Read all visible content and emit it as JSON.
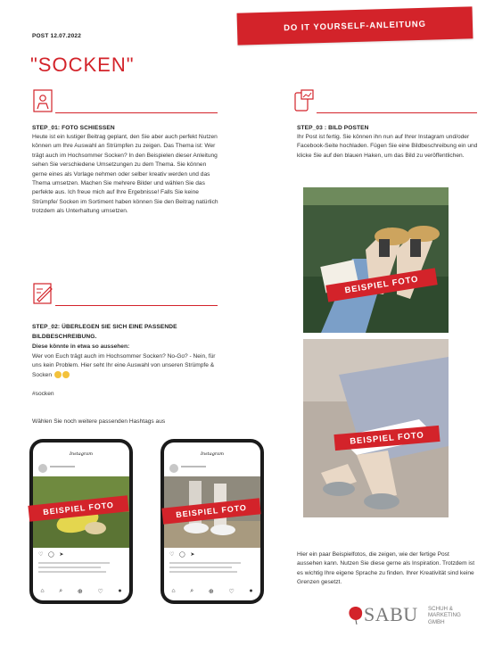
{
  "header": {
    "post_date": "POST 12.07.2022",
    "banner": "DO IT YOURSELF-ANLEITUNG",
    "title": "\"SOCKEN\""
  },
  "step1": {
    "heading": "STEP_01: FOTO SCHIESSEN",
    "text": "Heute ist ein lustiger Beitrag geplant, den Sie aber auch perfekt Nutzen können um Ihre Auswahl an Strümpfen zu zeigen. Das Thema ist: Wer trägt auch im Hochsommer Socken? In den Beispielen dieser Anleitung sehen Sie verschiedene Umsetzungen zu dem Thema. Sie können gerne eines als Vorlage nehmen oder selber kreativ werden und das Thema umsetzen. Machen Sie mehrere Bilder und wählen Sie das perfekte aus. Ich freue mich auf Ihre Ergebnisse! Falls Sie keine Strümpfe/ Socken im Sortiment haben können Sie den Beitrag natürlich trotzdem als Unterhaltung umsetzen."
  },
  "step2": {
    "heading_line1": "STEP_02: ÜBERLEGEN SIE SICH EINE PASSENDE",
    "heading_line2": "BILDBESCHREIBUNG.",
    "intro": "Diese könnte in etwa so aussehen:",
    "caption_text": "Wer von Euch trägt auch im Hochsommer Socken? No-Go? - Nein, für uns kein Problem. Hier seht Ihr eine Auswahl von unseren Strümpfe & Socken",
    "hashtag": "#socken",
    "hashtag_hint": "Wählen Sie noch weitere passenden Hashtags aus"
  },
  "step3": {
    "heading": "STEP_03 : BILD POSTEN",
    "text": "Ihr Post ist fertig. Sie können ihn nun auf Ihrer Instagram und/oder Facebook-Seite hochladen. Fügen Sie eine Bildbeschreibung ein und klicke Sie auf den blauen Haken, um das Bild zu veröffentlichen."
  },
  "phones": {
    "app_name": "Instagram",
    "stamp": "BEISPIEL FOTO"
  },
  "photos": {
    "stamp": "BEISPIEL FOTO"
  },
  "closing": {
    "text": "Hier ein paar Beispielfotos, die zeigen, wie der fertige Post aussehen kann. Nutzen Sie diese gerne als Inspiration. Trotzdem ist es wichtig Ihre eigene Sprache zu finden. Ihrer Kreativität sind keine Grenzen gesetzt."
  },
  "logo": {
    "brand": "SABU",
    "sub_line1": "SCHUH &",
    "sub_line2": "MARKETING",
    "sub_line3": "GMBH"
  },
  "colors": {
    "accent": "#d3232a",
    "text": "#2b2b2b",
    "logo_grey": "#7a7a7a"
  },
  "icons": [
    "camera-person-icon",
    "pencil-paper-icon",
    "phone-post-icon",
    "emoji-icon",
    "poppy-flower-icon"
  ]
}
